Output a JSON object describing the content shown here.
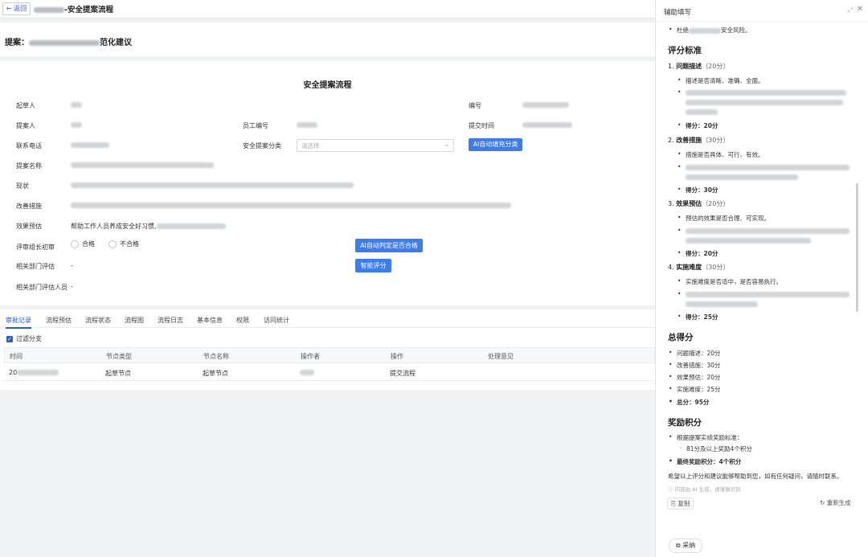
{
  "topbar": {
    "back_label": "← 返回",
    "flow_title": "-安全提案流程"
  },
  "proposal": {
    "title_prefix": "提案：",
    "title_suffix": "范化建议"
  },
  "form": {
    "title": "安全提案流程",
    "labels": {
      "drafter": "起草人",
      "number": "编号",
      "proposer": "提案人",
      "employee_no": "员工编号",
      "submit_time": "提交时间",
      "phone": "联系电话",
      "category": "安全提案分类",
      "proposal_name": "提案名称",
      "status": "现状",
      "measures": "改善措施",
      "effect": "效果预估",
      "leader_review": "评审组长初审",
      "dept_eval": "相关部门评估",
      "dept_evaluator": "相关部门评估人员"
    },
    "category_placeholder": "请选择",
    "ai_fill_button": "AI自动填充分类",
    "effect_value": "帮助工作人员养成安全好习惯,",
    "radio_pass": "合格",
    "radio_fail": "不合格",
    "ai_judge_button": "AI自动判定是否合格",
    "smart_score_button": "智能评分",
    "dept_eval_value": "-",
    "dept_evaluator_value": "-"
  },
  "tabs": [
    "审批记录",
    "流程预估",
    "流程状态",
    "流程图",
    "流程日志",
    "基本信息",
    "权限",
    "访问统计"
  ],
  "filter_label": "过滤分支",
  "table": {
    "headers": [
      "时间",
      "节点类型",
      "节点名称",
      "操作者",
      "操作",
      "处理意见"
    ],
    "rows": [
      {
        "time": "20",
        "node_type": "起草节点",
        "node_name": "起草节点",
        "operator": "",
        "action": "提交流程",
        "comment": ""
      }
    ]
  },
  "panel": {
    "title": "辅助填写",
    "top_bullet_prefix": "杜绝",
    "top_bullet_suffix": "安全风险。",
    "scoring_heading": "评分标准",
    "criteria": [
      {
        "index": "1.",
        "name": "问题描述",
        "points": "（20分）",
        "first": "描述是否清晰、准确、全面。",
        "score": "得分：20分"
      },
      {
        "index": "2.",
        "name": "改善措施",
        "points": "（30分）",
        "first": "措施是否具体、可行、有效。",
        "score": "得分：30分"
      },
      {
        "index": "3.",
        "name": "效果预估",
        "points": "（20分）",
        "first": "预估的效果是否合理、可实现。",
        "score": "得分：20分"
      },
      {
        "index": "4.",
        "name": "实施难度",
        "points": "（30分）",
        "first": "实施难度是否适中，是否容易执行。",
        "score": "得分：25分"
      }
    ],
    "total_heading": "总得分",
    "totals": [
      "问题描述：20分",
      "改善措施：30分",
      "效果预估：20分",
      "实施难度：25分",
      "总分：95分"
    ],
    "reward_heading": "奖励积分",
    "reward_rule": "根据提案实绩奖励标准：",
    "reward_sub": "81分及以上奖励4个积分",
    "reward_final": "最终奖励积分：4个积分",
    "closing": "希望以上评分和建议能够帮助到您，如有任何疑问，请随时联系。",
    "ai_note": "ⓘ 内容由 AI 生成，请谨慎识别",
    "copy_label": "⎘ 复制",
    "regen_label": "↻ 重新生成",
    "adopt_label": "⧉ 采纳"
  }
}
